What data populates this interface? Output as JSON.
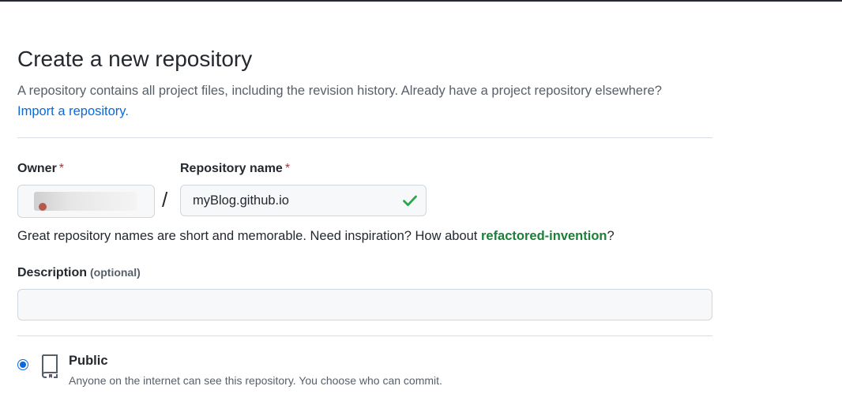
{
  "header": {
    "title": "Create a new repository",
    "subtitle": "A repository contains all project files, including the revision history. Already have a project repository elsewhere?",
    "import_link": "Import a repository."
  },
  "owner": {
    "label": "Owner",
    "required_mark": "*"
  },
  "separator": "/",
  "repo_name": {
    "label": "Repository name",
    "required_mark": "*",
    "value": "myBlog.github.io",
    "valid_icon": "check-icon"
  },
  "hint": {
    "prefix": "Great repository names are short and memorable. Need inspiration? How about ",
    "suggestion": "refactored-invention",
    "suffix": "?"
  },
  "description": {
    "label": "Description",
    "optional": "(optional)",
    "value": ""
  },
  "visibility": {
    "public_label": "Public",
    "public_desc": "Anyone on the internet can see this repository. You choose who can commit.",
    "selected": "public"
  },
  "colors": {
    "link": "#0969da",
    "success": "#1a7f37",
    "required": "#cf222e"
  }
}
